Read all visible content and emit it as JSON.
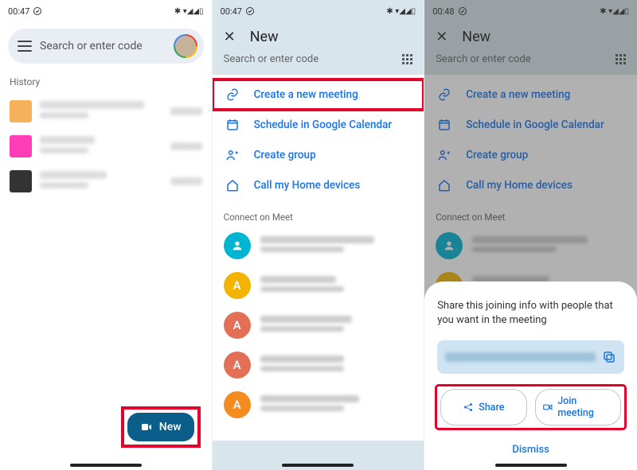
{
  "status1": {
    "time": "00:47"
  },
  "status2": {
    "time": "00:47"
  },
  "status3": {
    "time": "00:48"
  },
  "screen1": {
    "search_placeholder": "Search or enter code",
    "history_label": "History",
    "fab_label": "New"
  },
  "screen2": {
    "title": "New",
    "search_placeholder": "Search or enter code",
    "options": [
      {
        "icon": "link-icon",
        "label": "Create a new meeting"
      },
      {
        "icon": "calendar-icon",
        "label": "Schedule in Google Calendar"
      },
      {
        "icon": "group-add-icon",
        "label": "Create group"
      },
      {
        "icon": "home-icon",
        "label": "Call my Home devices"
      }
    ],
    "connect_label": "Connect on Meet",
    "contacts": [
      {
        "avatar_letter": "",
        "color": "cyan"
      },
      {
        "avatar_letter": "A",
        "color": "yel"
      },
      {
        "avatar_letter": "A",
        "color": "red"
      },
      {
        "avatar_letter": "A",
        "color": "red"
      },
      {
        "avatar_letter": "A",
        "color": "orange"
      }
    ]
  },
  "screen3": {
    "title": "New",
    "search_placeholder": "Search or enter code",
    "options": [
      {
        "label": "Create a new meeting"
      },
      {
        "label": "Schedule in Google Calendar"
      },
      {
        "label": "Create group"
      },
      {
        "label": "Call my Home devices"
      }
    ],
    "connect_label": "Connect on Meet",
    "sheet": {
      "message": "Share this joining info with people that you want in the meeting",
      "share_label": "Share",
      "join_label": "Join meeting",
      "dismiss_label": "Dismiss"
    }
  }
}
